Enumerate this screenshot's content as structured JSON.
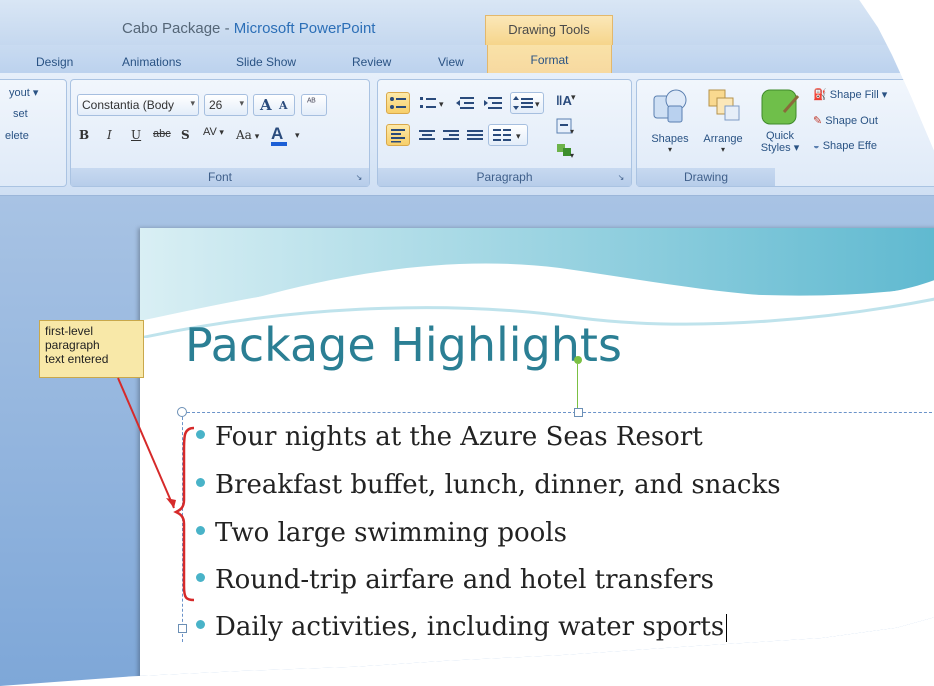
{
  "window": {
    "doc_title": "Cabo Package",
    "separator": " - ",
    "app_name": "Microsoft PowerPoint",
    "context_tab_group": "Drawing Tools"
  },
  "tabs": [
    "Design",
    "Animations",
    "Slide Show",
    "Review",
    "View"
  ],
  "context_tab": "Format",
  "ribbon": {
    "slides_partial": [
      "yout",
      "set",
      "elete"
    ],
    "font": {
      "label": "Font",
      "font_name": "Constantia (Body",
      "font_size": "26",
      "grow": "A",
      "shrink": "A",
      "bold": "B",
      "italic": "I",
      "underline": "U",
      "strike": "abc",
      "shadow": "S",
      "spacing": "AV",
      "case": "Aa",
      "color": "A"
    },
    "paragraph": {
      "label": "Paragraph"
    },
    "drawing": {
      "label": "Drawing",
      "shapes": "Shapes",
      "arrange": "Arrange",
      "quick_styles_1": "Quick",
      "quick_styles_2": "Styles",
      "shape_fill": "Shape Fill",
      "shape_outline": "Shape Out",
      "shape_effects": "Shape Effe"
    }
  },
  "slide": {
    "title": "Package Highlights",
    "bullets": [
      "Four nights at the Azure Seas Resort",
      "Breakfast buffet, lunch, dinner, and snacks",
      "Two large swimming pools",
      "Round-trip airfare and hotel transfers",
      "Daily activities, including water sports"
    ]
  },
  "callout": {
    "line1": "first-level",
    "line2": "paragraph",
    "line3": "text entered"
  },
  "colors": {
    "accent_title": "#2b7f94",
    "bullet": "#49b3c8",
    "callout_bg": "#f8e8a8",
    "callout_arrow": "#d62a2a"
  }
}
